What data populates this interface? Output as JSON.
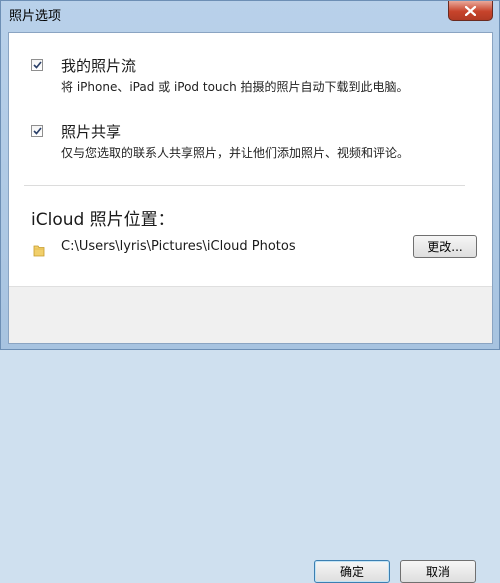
{
  "window": {
    "title": "照片选项"
  },
  "options": [
    {
      "label": "我的照片流",
      "description": "将 iPhone、iPad 或 iPod touch 拍摄的照片自动下载到此电脑。",
      "checked": true
    },
    {
      "label": "照片共享",
      "description": "仅与您选取的联系人共享照片，并让他们添加照片、视频和评论。",
      "checked": true
    }
  ],
  "location": {
    "heading": "iCloud 照片位置：",
    "path": "C:\\Users\\lyris\\Pictures\\iCloud Photos",
    "change_label": "更改..."
  },
  "footer": {
    "ok_label": "确定",
    "cancel_label": "取消"
  },
  "icons": {
    "close": "close-icon",
    "checkbox": "checkmark-icon",
    "folder": "folder-icon"
  },
  "colors": {
    "titlebar": "#b9d1ea",
    "close_button": "#c7432b",
    "client_bg": "#ffffff",
    "footer_bg": "#f0f0f0",
    "focus_border": "#3c7fb1"
  }
}
